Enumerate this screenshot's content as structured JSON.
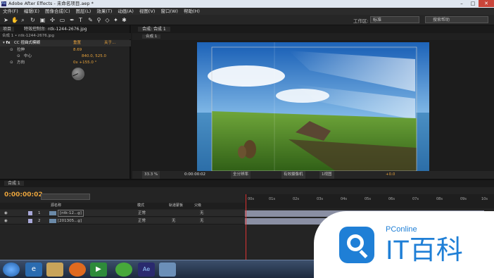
{
  "window": {
    "title": "Adobe After Effects - 未命名项目.aep *"
  },
  "menu": [
    "文件(F)",
    "编辑(E)",
    "图像合成(C)",
    "图层(L)",
    "效果(T)",
    "动画(A)",
    "视图(V)",
    "窗口(W)",
    "帮助(H)"
  ],
  "toolbar": {
    "workspace_label": "工作区:",
    "workspace_value": "标准",
    "search_placeholder": "搜索帮助"
  },
  "left_panel": {
    "tab_project": "项目",
    "tab_effects": "特效控制台: ntk-1244-2676.jpg",
    "subheader": "合成 1 • ntk-1244-2676.jpg",
    "effect_name": "CC 扭曲式模糊",
    "reset": "重置",
    "about": "关于...",
    "props": [
      {
        "name": "拉伸",
        "value": "8.69"
      },
      {
        "name": "中心",
        "value": "840.0, 525.0"
      },
      {
        "name": "方向",
        "value": "0x +155.0 °"
      }
    ]
  },
  "comp_panel": {
    "tab_label": "合成: 合成 1",
    "sub_tab": "合成 1",
    "footer": {
      "zoom": "33.3 %",
      "timecode": "0:00:00:02",
      "resolution": "全分辨率",
      "camera": "有效摄像机",
      "views": "1视图",
      "exposure": "+0.0"
    }
  },
  "timeline": {
    "tab_label": "合成 1",
    "timecode": "0:00:00:02",
    "headers": {
      "source": "源名称",
      "mode": "模式",
      "trkmat": "轨道蒙板",
      "parent": "父级"
    },
    "layers": [
      {
        "num": "1",
        "name": "[ntk-12...g]",
        "mode": "正常",
        "trkmat": "",
        "parent": "无"
      },
      {
        "num": "2",
        "name": "[201305...g]",
        "mode": "正常",
        "trkmat": "无",
        "parent": "无"
      }
    ],
    "ruler": [
      "00s",
      "01s",
      "02s",
      "03s",
      "04s",
      "05s",
      "06s",
      "07s",
      "08s",
      "09s",
      "10s"
    ]
  },
  "watermark": {
    "brand": "PConline",
    "logo_text": "IT百科"
  },
  "colors": {
    "accent_orange": "#e8a33c",
    "brand_blue": "#1f7fd6"
  }
}
